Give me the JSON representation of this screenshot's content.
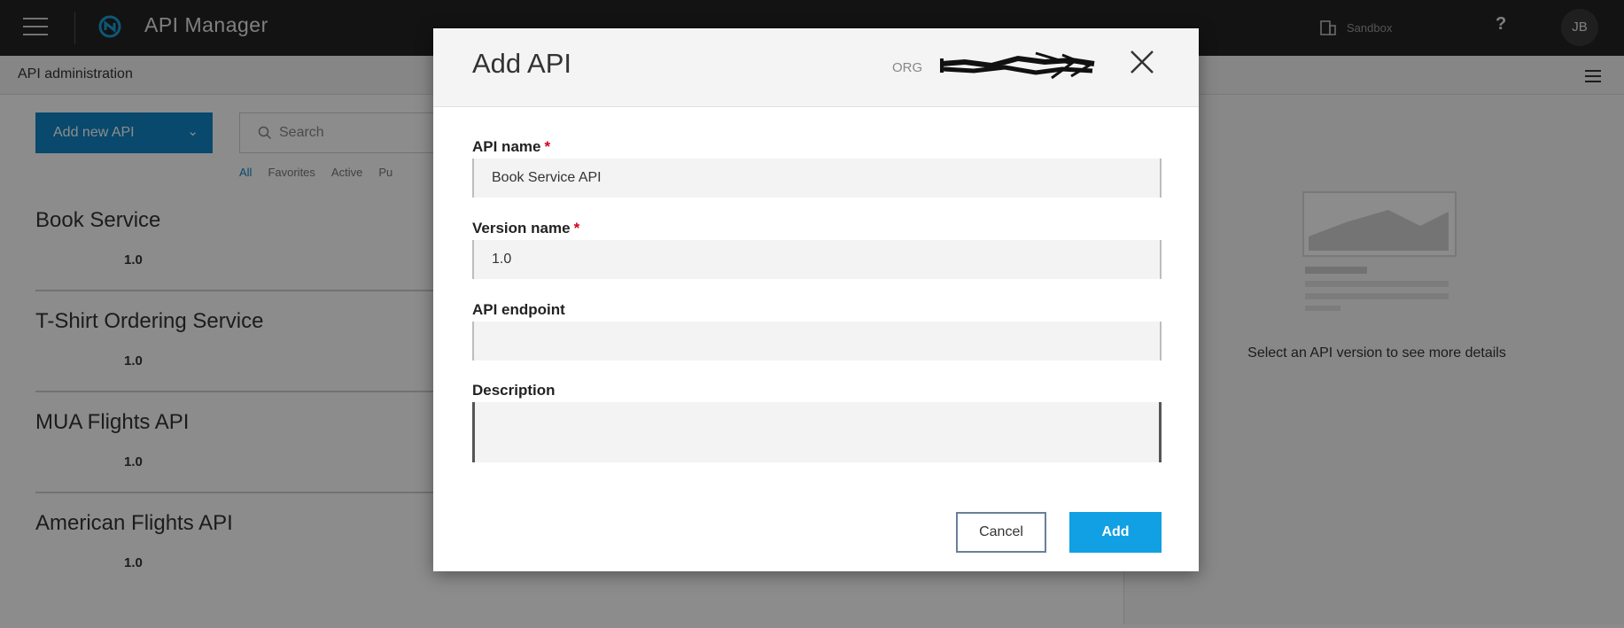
{
  "topbar": {
    "app_title": "API Manager",
    "org_switch_label": "Sandbox",
    "help_label": "?",
    "avatar_initials": "JB"
  },
  "subbar": {
    "section_title": "API administration"
  },
  "list": {
    "add_button_label": "Add new API",
    "search_placeholder": "Search",
    "filters": [
      "All",
      "Favorites",
      "Active",
      "Pu"
    ],
    "items": [
      {
        "name": "Book Service",
        "version": "1.0"
      },
      {
        "name": "T-Shirt Ordering Service",
        "version": "1.0"
      },
      {
        "name": "MUA Flights API",
        "version": "1.0"
      },
      {
        "name": "American Flights API",
        "version": "1.0"
      }
    ]
  },
  "detail": {
    "placeholder_text": "Select an API version to see more details"
  },
  "modal": {
    "title": "Add API",
    "org_label": "ORG",
    "fields": {
      "api_name": {
        "label": "API name",
        "required_marker": "*",
        "value": "Book Service API"
      },
      "version_name": {
        "label": "Version name",
        "required_marker": "*",
        "value": "1.0"
      },
      "api_endpoint": {
        "label": "API endpoint",
        "value": ""
      },
      "description": {
        "label": "Description",
        "value": ""
      }
    },
    "cancel_label": "Cancel",
    "add_label": "Add"
  },
  "colors": {
    "topbar": "#242424",
    "primary": "#0f86c6",
    "add_button": "#11a0e3",
    "required": "#d0021b"
  }
}
